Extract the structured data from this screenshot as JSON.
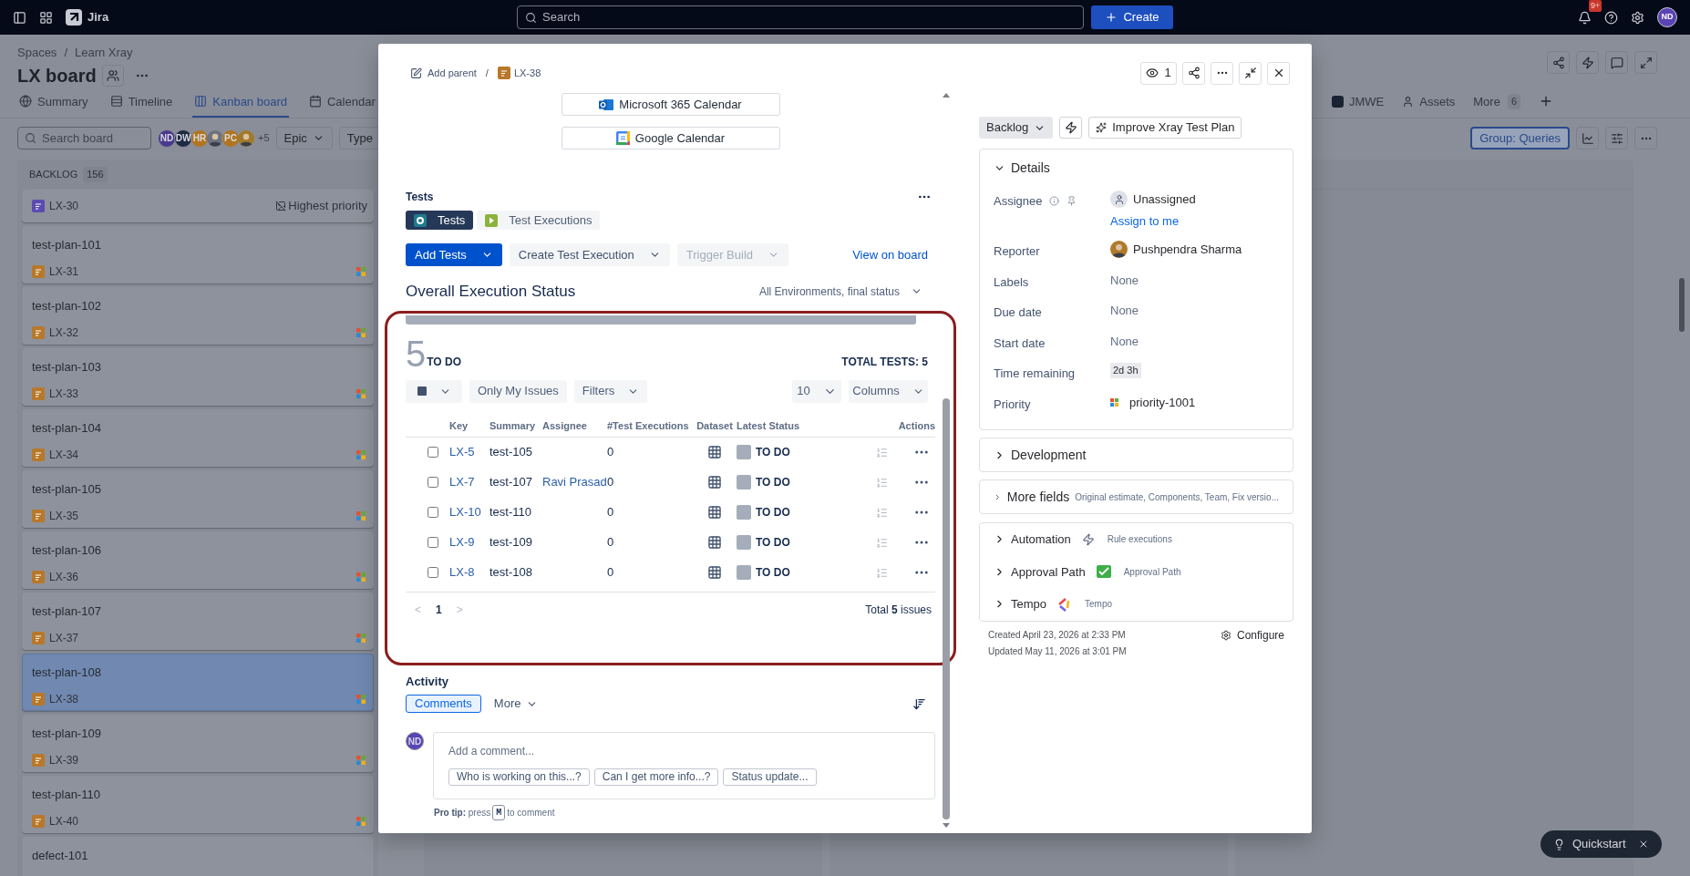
{
  "topbar": {
    "product": "Jira",
    "search_placeholder": "Search",
    "create": "Create",
    "badge": "9+",
    "user": "ND"
  },
  "page": {
    "breadcrumb": [
      "Spaces",
      "/",
      "Learn Xray"
    ],
    "title": "LX board",
    "tabs": [
      {
        "label": "Summary",
        "selected": false
      },
      {
        "label": "Timeline",
        "selected": false
      },
      {
        "label": "Kanban board",
        "selected": true
      },
      {
        "label": "Calendar",
        "selected": false
      }
    ],
    "tabs_right": [
      {
        "label": "JMWE",
        "selected": false
      },
      {
        "label": "Assets",
        "selected": false
      },
      {
        "label": "More",
        "count": "6",
        "selected": false
      }
    ],
    "search_placeholder": "Search board",
    "avatars": [
      {
        "kind": "initials",
        "initials": "ND",
        "color": "#4a3a8c"
      },
      {
        "kind": "initials",
        "initials": "DW",
        "color": "#1f2a44"
      },
      {
        "kind": "initials",
        "initials": "HR",
        "color": "#b07520"
      },
      {
        "kind": "photo",
        "color": "#6b7280"
      },
      {
        "kind": "initials",
        "initials": "PC",
        "color": "#b07520"
      },
      {
        "kind": "photo",
        "color": "#a17a2a"
      }
    ],
    "avatar_more": "+5",
    "filters": [
      {
        "label": "Epic",
        "dropdown": true
      },
      {
        "label": "Type",
        "dropdown": false
      }
    ],
    "group": "Group: Queries",
    "column": {
      "title": "BACKLOG",
      "count": "156",
      "cards": [
        {
          "key": "LX-30",
          "kind": "subtask",
          "priority_alt": "Highest priority",
          "selected": false
        },
        {
          "title": "test-plan-101",
          "key": "LX-31",
          "kind": "plan",
          "selected": false
        },
        {
          "title": "test-plan-102",
          "key": "LX-32",
          "kind": "plan",
          "selected": false
        },
        {
          "title": "test-plan-103",
          "key": "LX-33",
          "kind": "plan",
          "selected": false
        },
        {
          "title": "test-plan-104",
          "key": "LX-34",
          "kind": "plan",
          "selected": false
        },
        {
          "title": "test-plan-105",
          "key": "LX-35",
          "kind": "plan",
          "selected": false
        },
        {
          "title": "test-plan-106",
          "key": "LX-36",
          "kind": "plan",
          "selected": false
        },
        {
          "title": "test-plan-107",
          "key": "LX-37",
          "kind": "plan",
          "selected": false
        },
        {
          "title": "test-plan-108",
          "key": "LX-38",
          "kind": "plan",
          "selected": true
        },
        {
          "title": "test-plan-109",
          "key": "LX-39",
          "kind": "plan",
          "selected": false
        },
        {
          "title": "test-plan-110",
          "key": "LX-40",
          "kind": "plan",
          "selected": false
        },
        {
          "title": "defect-101",
          "selected": false
        }
      ]
    }
  },
  "issue": {
    "parent_action": "Add parent",
    "separator": "/",
    "key": "LX-38",
    "watchers": "1",
    "calendar_buttons": [
      {
        "label": "Microsoft 365 Calendar",
        "kind": "outlook"
      },
      {
        "label": "Google Calendar",
        "kind": "google"
      }
    ],
    "tests": {
      "title": "Tests",
      "tabs": [
        {
          "label": "Tests",
          "kind": "tests",
          "selected": true
        },
        {
          "label": "Test Executions",
          "kind": "executions",
          "selected": false
        }
      ],
      "actions": [
        {
          "label": "Add Tests",
          "kind": "primary",
          "disabled": false
        },
        {
          "label": "Create Test Execution",
          "kind": "default",
          "disabled": false
        },
        {
          "label": "Trigger Build",
          "disabled": true
        }
      ],
      "view_link": "View on board",
      "status_title": "Overall Execution Status",
      "environment": "All Environments, final status",
      "status_bar": {
        "level": 1
      },
      "count": "5",
      "count_label": "TO DO",
      "total": "TOTAL TESTS: 5",
      "toolbar": {
        "buttons": [
          {
            "label": "Only My Issues",
            "dropdown": false
          },
          {
            "label": "Filters",
            "dropdown": true
          }
        ],
        "page_size": "10",
        "columns": "Columns"
      },
      "table": {
        "columns": [
          "Key",
          "Summary",
          "Assignee",
          "#Test Executions",
          "Dataset",
          "Latest Status",
          "Actions"
        ],
        "rows": [
          {
            "key": "LX-5",
            "summary": "test-105",
            "executions": "0",
            "status": "TO DO",
            "checked": false
          },
          {
            "key": "LX-7",
            "summary": "test-107",
            "assignee": "Ravi Prasad",
            "executions": "0",
            "status": "TO DO",
            "checked": false
          },
          {
            "key": "LX-10",
            "summary": "test-110",
            "executions": "0",
            "status": "TO DO",
            "checked": false
          },
          {
            "key": "LX-9",
            "summary": "test-109",
            "executions": "0",
            "status": "TO DO",
            "checked": false
          },
          {
            "key": "LX-8",
            "summary": "test-108",
            "executions": "0",
            "status": "TO DO",
            "checked": false
          }
        ]
      },
      "pagination": {
        "prev": "<",
        "page": "1",
        "next": ">",
        "total": "Total **5** issues"
      }
    },
    "activity": {
      "title": "Activity",
      "tabs": [
        {
          "label": "Comments",
          "selected": true
        }
      ],
      "more": "More",
      "avatar": "ND",
      "placeholder": "Add a comment...",
      "suggestions": [
        "Who is working on this...?",
        "Can I get more info...?",
        "Status update..."
      ],
      "tip": "**Pro tip:** press",
      "tip_key": "M",
      "tip_end": "to comment"
    },
    "status": "Backlog",
    "improve": "Improve Xray Test Plan",
    "details": {
      "title": "Details",
      "expanded": true,
      "fields": [
        {
          "label": "Assignee",
          "kind": "assignee",
          "value": "Unassigned",
          "action": "Assign to me"
        },
        {
          "label": "Reporter",
          "kind": "user",
          "value": "Pushpendra Sharma"
        },
        {
          "label": "Labels",
          "kind": "none",
          "value": "None"
        },
        {
          "label": "Due date",
          "kind": "none",
          "value": "None"
        },
        {
          "label": "Start date",
          "kind": "none",
          "value": "None"
        },
        {
          "label": "Time remaining",
          "kind": "tag",
          "value": "2d 3h"
        },
        {
          "label": "Priority",
          "kind": "priority",
          "value": "priority-1001"
        }
      ]
    },
    "sections": [
      {
        "title": "Development",
        "expanded": false
      },
      {
        "title": "More fields",
        "hint": "Original estimate, Components, Team, Fix versio...",
        "expanded": false
      }
    ],
    "apps": [
      {
        "title": "Automation",
        "kind": "automation",
        "hint": "Rule executions",
        "expanded": false
      },
      {
        "title": "Approval Path",
        "kind": "approval",
        "hint": "Approval Path",
        "expanded": false
      },
      {
        "title": "Tempo",
        "kind": "tempo",
        "hint": "Tempo",
        "expanded": false
      }
    ],
    "created": "Created April 23, 2026 at 2:33 PM",
    "updated": "Updated May 11, 2026 at 3:01 PM",
    "configure": "Configure"
  },
  "quickstart": "Quickstart"
}
